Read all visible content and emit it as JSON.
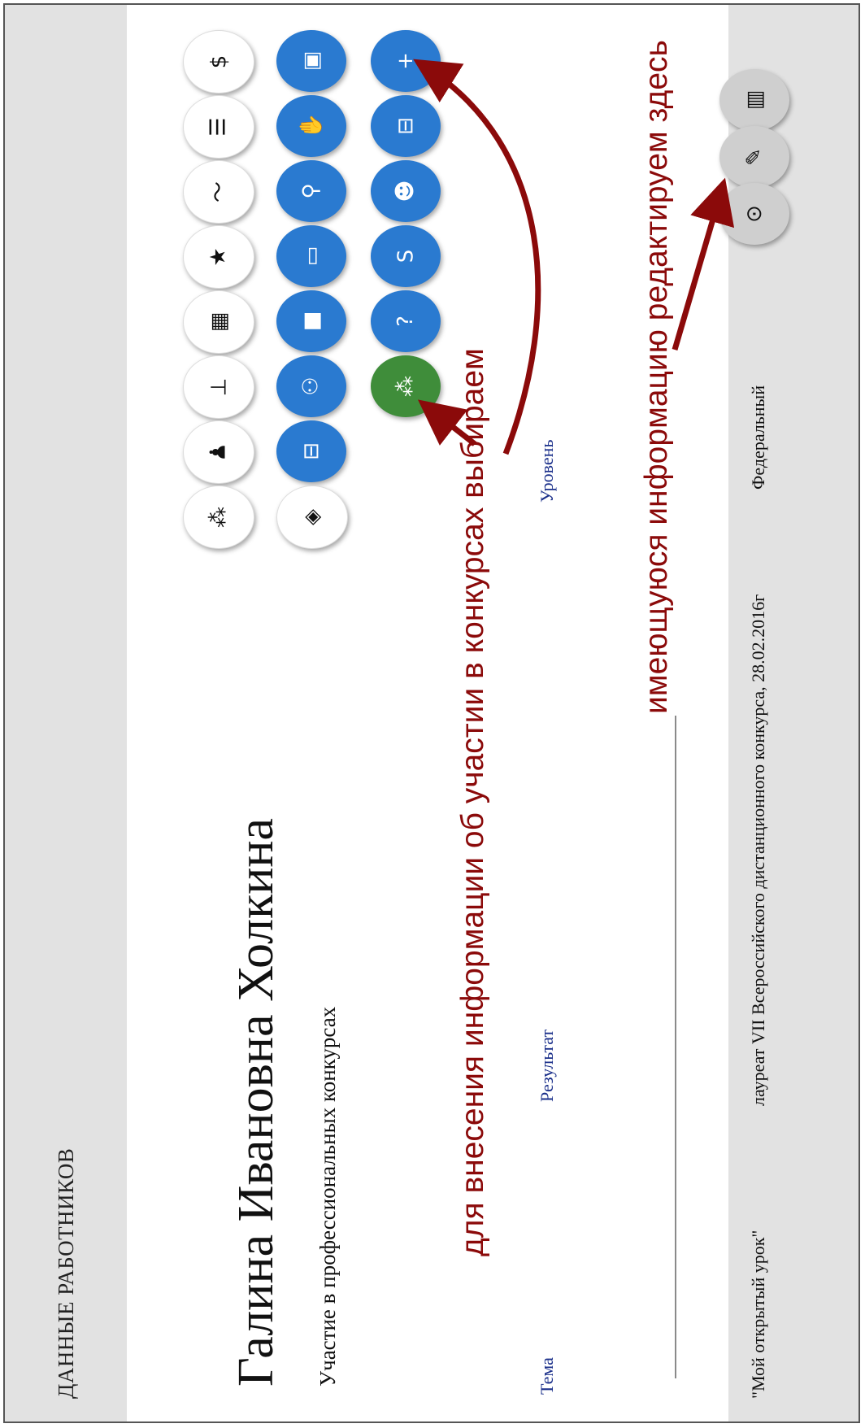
{
  "header": {
    "title": "ДАННЫЕ РАБОТНИКОВ"
  },
  "person": {
    "name": "Галина Ивановна Холкина"
  },
  "section": {
    "title": "Участие в профессиональных конкурсах"
  },
  "table": {
    "columns": [
      "Тема",
      "Результат",
      "Уровень"
    ],
    "rows": [
      [
        "\"Мой открытый урок\"",
        "лауреат VII Всероссийского дистанционного конкурса, 28.02.2016г",
        "Федеральный"
      ]
    ]
  },
  "annotations": {
    "add_info": "для внесения информации об участии в конкурсах выбираем",
    "edit_info": "имеющуюся информацию редактируем здесь"
  },
  "toolbar": {
    "white_icons": [
      "dollar-icon",
      "list-icon",
      "chart-icon",
      "star-icon",
      "calendar-icon",
      "teacher-icon",
      "person-icon",
      "group-icon"
    ],
    "blue_icons": [
      "briefcase-icon",
      "hands-icon",
      "podium-icon",
      "card-icon",
      "bag-icon",
      "people-icon",
      "school-icon",
      "book-icon"
    ],
    "blue_icons_row3": [
      "plus-icon",
      "building-icon",
      "smiley-icon",
      "skype-icon",
      "help-icon",
      "competition-icon"
    ],
    "row_actions": [
      "delete-icon",
      "edit-icon",
      "view-icon"
    ]
  },
  "colors": {
    "accent_blue": "#2a7ad0",
    "accent_green": "#3f8d3a",
    "annotation_red": "#8b0a0a",
    "header_blue": "#1a2f8a"
  }
}
